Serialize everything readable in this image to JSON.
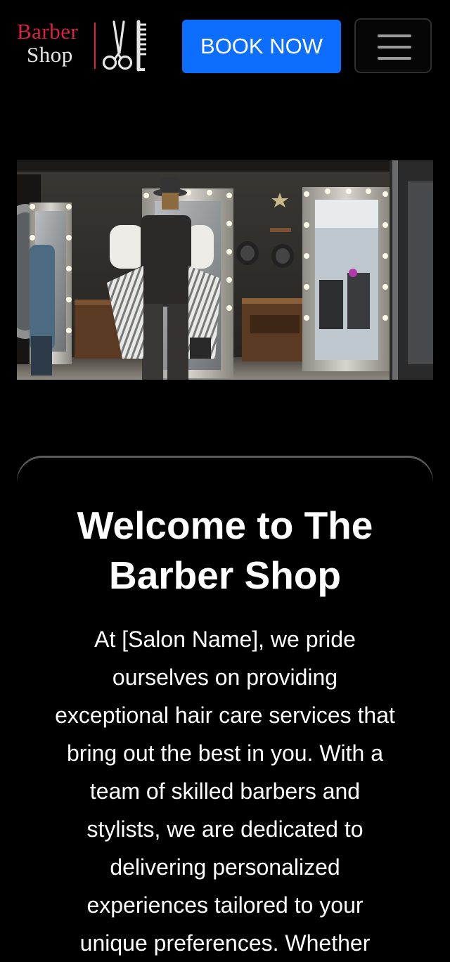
{
  "header": {
    "logo": {
      "line1": "Barber",
      "line2": "Shop",
      "icon": "scissors-comb-icon",
      "accent_color": "#d8243c"
    },
    "book_button_label": "BOOK NOW",
    "book_button_color": "#0d6efd",
    "menu_icon": "hamburger-menu-icon"
  },
  "hero": {
    "image": "barber-shop-interior-photo"
  },
  "welcome": {
    "title": "Welcome to The Barber Shop",
    "body": "At [Salon Name], we pride ourselves on providing exceptional hair care services that bring out the best in you. With a team of skilled barbers and stylists, we are dedicated to delivering personalized experiences tailored to your unique preferences. Whether"
  }
}
